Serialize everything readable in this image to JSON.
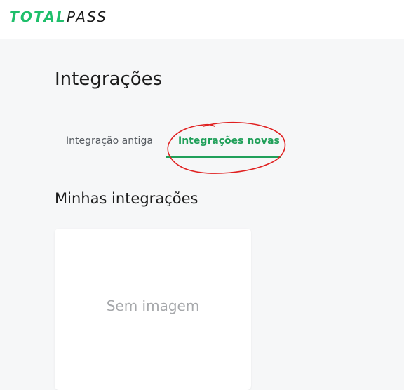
{
  "brand": {
    "logo_part1": "TOTAL",
    "logo_part2": "PASS",
    "accent_color": "#1fbf6b"
  },
  "page": {
    "title": "Integrações"
  },
  "tabs": [
    {
      "label": "Integração antiga",
      "active": false
    },
    {
      "label": "Integrações novas",
      "active": true
    }
  ],
  "section": {
    "title": "Minhas integrações"
  },
  "integration_card": {
    "placeholder": "Sem imagem"
  },
  "annotation": {
    "color": "#e02020"
  }
}
